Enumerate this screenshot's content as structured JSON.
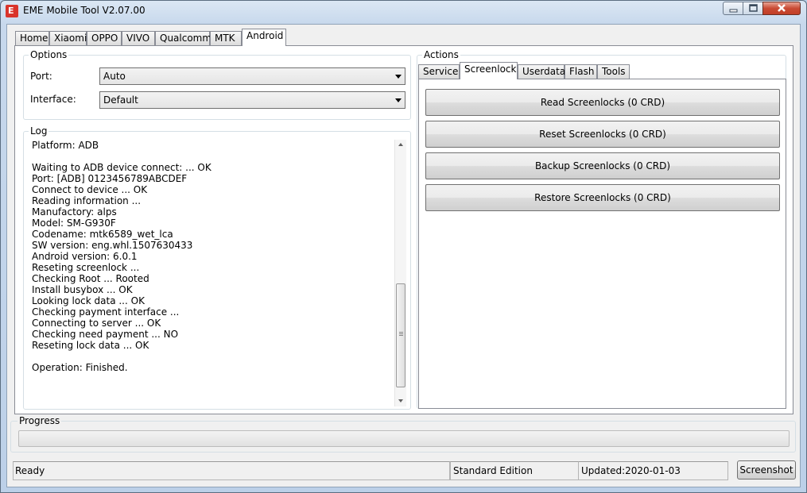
{
  "window": {
    "title": "EME Mobile Tool V2.07.00",
    "app_icon_letter": "E"
  },
  "main_tabs": [
    {
      "label": "Home"
    },
    {
      "label": "Xiaomi"
    },
    {
      "label": "OPPO"
    },
    {
      "label": "VIVO"
    },
    {
      "label": "Qualcomm"
    },
    {
      "label": "MTK"
    },
    {
      "label": "Android"
    }
  ],
  "active_main_tab": "Android",
  "options": {
    "title": "Options",
    "port_label": "Port:",
    "port_value": "Auto",
    "interface_label": "Interface:",
    "interface_value": "Default"
  },
  "log": {
    "title": "Log",
    "lines": [
      "Platform: ADB",
      "",
      "Waiting to ADB device connect: ... OK",
      "Port: [ADB] 0123456789ABCDEF",
      "Connect to device ... OK",
      "Reading information ...",
      "Manufactory: alps",
      "Model: SM-G930F",
      "Codename: mtk6589_wet_lca",
      "SW version: eng.whl.1507630433",
      "Android version: 6.0.1",
      "Reseting screenlock ...",
      "Checking Root ... Rooted",
      "Install busybox ... OK",
      "Looking lock data ... OK",
      "Checking payment interface ...",
      "Connecting to server ... OK",
      "Checking need payment ... NO",
      "Reseting lock data ... OK",
      "",
      "Operation: Finished."
    ]
  },
  "actions": {
    "title": "Actions",
    "tabs": [
      {
        "label": "Service"
      },
      {
        "label": "Screenlock"
      },
      {
        "label": "Userdata"
      },
      {
        "label": "Flash"
      },
      {
        "label": "Tools"
      }
    ],
    "active_tab": "Screenlock",
    "buttons": [
      {
        "label": "Read Screenlocks (0 CRD)"
      },
      {
        "label": "Reset Screenlocks (0 CRD)"
      },
      {
        "label": "Backup Screenlocks (0 CRD)"
      },
      {
        "label": "Restore Screenlocks (0 CRD)"
      }
    ]
  },
  "progress": {
    "title": "Progress",
    "value_percent": 0
  },
  "status": {
    "state": "Ready",
    "edition": "Standard Edition",
    "updated": "Updated:2020-01-03",
    "screenshot_label": "Screenshot"
  },
  "icons": [
    "minimize-icon",
    "maximize-icon",
    "close-icon",
    "scroll-up-icon",
    "scroll-down-icon",
    "dropdown-arrow-icon"
  ],
  "colors": {
    "app_icon": "#d9342b",
    "close_button": "#c94b34",
    "window_frame": "#b9d1ea"
  }
}
